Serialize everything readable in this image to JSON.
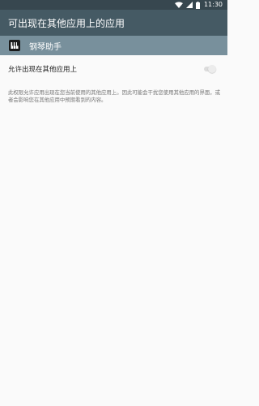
{
  "status_bar": {
    "time": "11:30",
    "icons": [
      "wifi-icon",
      "signal-icon",
      "battery-icon"
    ],
    "background": "#37474f"
  },
  "app_bar": {
    "title": "可出现在其他应用上的应用",
    "background": "#455a64"
  },
  "app": {
    "name": "钢琴助手",
    "icon": "piano-app-icon",
    "row_background": "#78909c"
  },
  "setting": {
    "label": "允许出现在其他应用上",
    "enabled": false
  },
  "description": "此权限允许应用出现在您当前使用的其他应用上。因此可能会干扰您使用其他应用的界面，或者会影响您在其他应用中预期看到的内容。"
}
